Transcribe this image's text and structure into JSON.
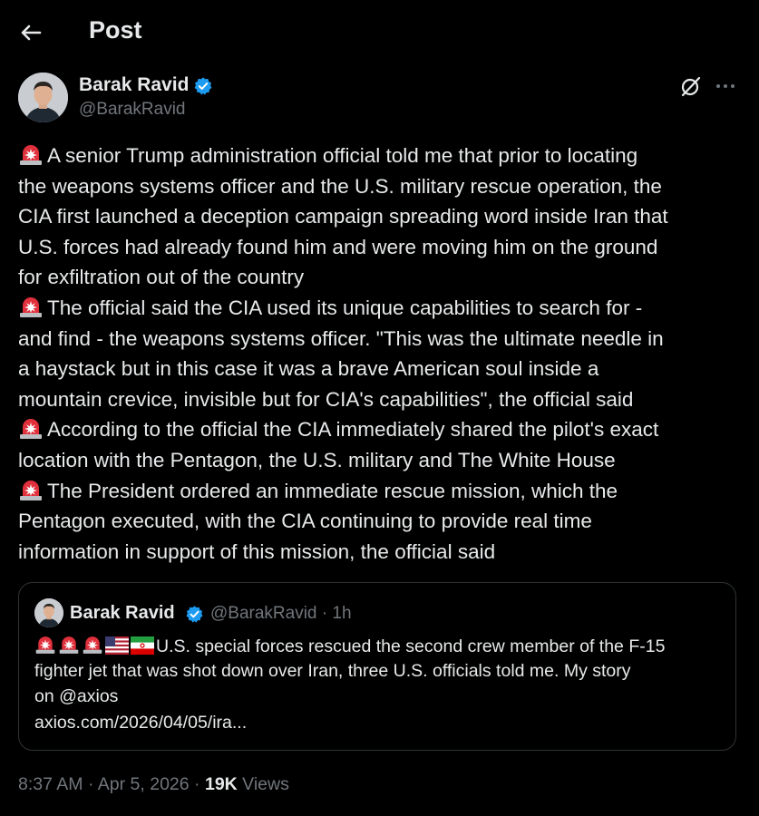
{
  "header": {
    "title": "Post"
  },
  "author": {
    "name": "Barak Ravid",
    "handle": "@BarakRavid"
  },
  "post": {
    "lines": [
      "A senior Trump administration official told me that prior to locating",
      "the weapons systems officer and the U.S. military rescue operation, the",
      "CIA first launched a deception campaign spreading word inside Iran that",
      "U.S. forces had already found him and were moving him on the ground",
      "for exfiltration out of the country",
      "The official said the CIA used its unique capabilities to search for -",
      "and find - the weapons systems officer. \"This was the ultimate needle in",
      "a haystack but in this case it was a brave American soul inside a",
      "mountain crevice, invisible but for CIA's capabilities\", the official said",
      "According to the official the CIA immediately shared the pilot's exact",
      "location with the Pentagon, the U.S. military and The White House",
      "The President ordered an immediate rescue mission, which the",
      "Pentagon executed, with the CIA continuing to provide real time",
      "information in support of this mission, the official said"
    ]
  },
  "quote": {
    "name": "Barak Ravid",
    "handle": "@BarakRavid · 1h",
    "lines": [
      "U.S. special forces rescued the second crew member of the F-15",
      "fighter jet that was shot down over Iran, three U.S. officials told me. My story",
      "on @axios",
      "axios.com/2026/04/05/ira..."
    ]
  },
  "meta": {
    "timestamp": "8:37 AM · Apr 5, 2026 ·",
    "views_count": "19K",
    "views_label": "Views"
  },
  "icons": {
    "back": "back-arrow-icon",
    "verified": "verified-badge-icon",
    "grok": "grok-icon",
    "more": "more-icon",
    "siren": "rotating-light-emoji",
    "us_flag": "us-flag-emoji",
    "iran_flag": "iran-flag-emoji"
  },
  "colors": {
    "background": "#000000",
    "text": "#e7e9ea",
    "muted": "#71767b",
    "verified": "#1d9bf0",
    "border": "#2f3336",
    "siren": "#e0303c"
  }
}
